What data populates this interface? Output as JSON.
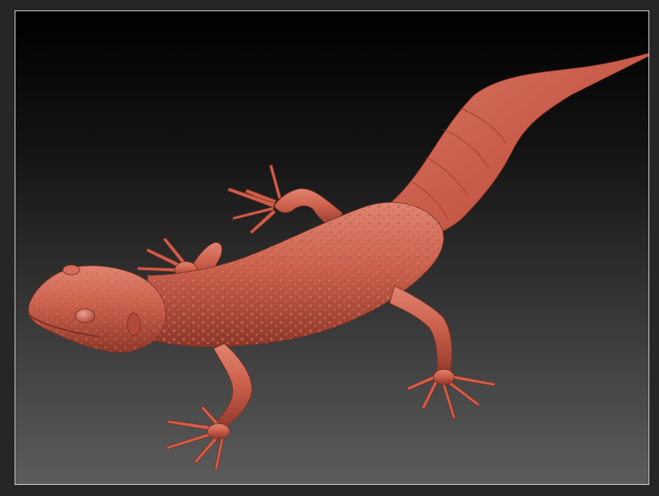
{
  "scene": {
    "subject": "gecko-sculpt",
    "background_top": "#000000",
    "background_bottom": "#5c5c5c",
    "frame_color": "#e8e8e8",
    "material_color": "#c75a48",
    "material_highlight": "#e0806c",
    "material_shadow": "#8a3426"
  }
}
